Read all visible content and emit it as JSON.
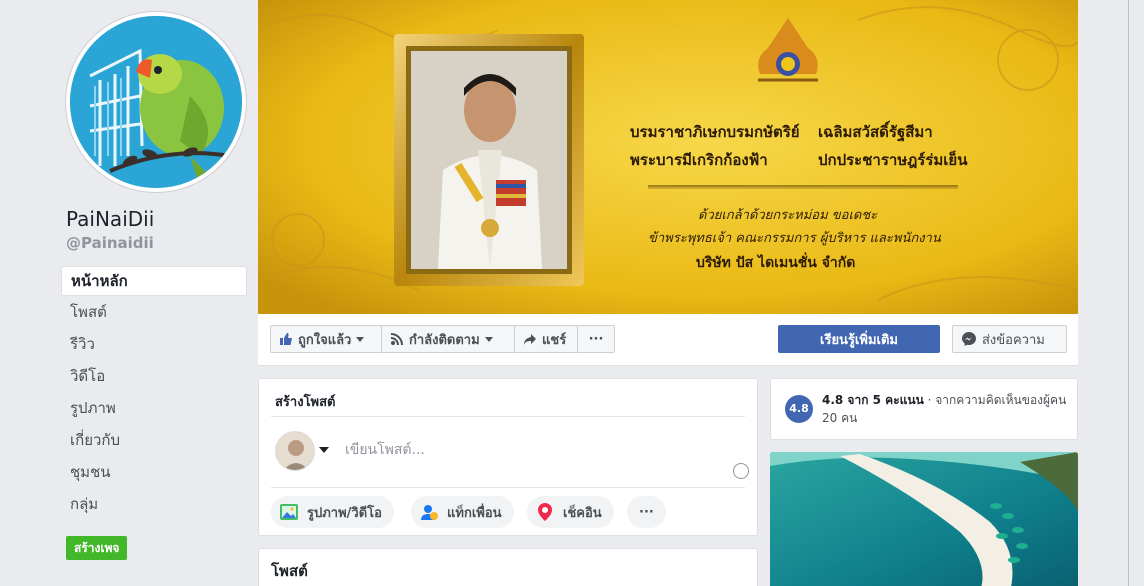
{
  "page": {
    "name": "PaiNaiDii",
    "handle": "@Painaidii"
  },
  "nav": {
    "items": [
      {
        "label": "หน้าหลัก",
        "active": true
      },
      {
        "label": "โพสต์"
      },
      {
        "label": "รีวิว"
      },
      {
        "label": "วิดีโอ"
      },
      {
        "label": "รูปภาพ"
      },
      {
        "label": "เกี่ยวกับ"
      },
      {
        "label": "ชุมชน"
      },
      {
        "label": "กลุ่ม"
      }
    ],
    "create_page_label": "สร้างเพจ"
  },
  "cover": {
    "line1_left": "บรมราชาภิเษกบรมกษัตริย์",
    "line1_right": "เฉลิมสวัสดิ์รัฐสีมา",
    "line2_left": "พระบารมีเกริกก้องฟ้า",
    "line2_right": "ปกประชาราษฎร์ร่มเย็น",
    "line3": "ด้วยเกล้าด้วยกระหม่อม ขอเดชะ",
    "line4": "ข้าพระพุทธเจ้า คณะกรรมการ ผู้บริหาร และพนักงาน",
    "line5": "บริษัท ปัส ไดเมนชั่น จำกัด",
    "colors": {
      "gold": "#f0c419",
      "frame": "#c9a227"
    }
  },
  "actions": {
    "like_label": "ถูกใจแล้ว",
    "follow_label": "กำลังติดตาม",
    "share_label": "แชร์",
    "more_label": "···",
    "learn_more_label": "เรียนรู้เพิ่มเติม",
    "message_label": "ส่งข้อความ"
  },
  "composer": {
    "title": "สร้างโพสต์",
    "placeholder": "เขียนโพสต์...",
    "photo_video_label": "รูปภาพ/วิดีโอ",
    "tag_friends_label": "แท็กเพื่อน",
    "check_in_label": "เช็คอิน",
    "more_label": "···"
  },
  "posts": {
    "title": "โพสต์"
  },
  "rating": {
    "badge": "4.8",
    "score_text": "4.8 จาก 5 คะแนน",
    "separator": " · ",
    "source_text": "จากความคิดเห็นของผู้คน 20 คน"
  },
  "theme": {
    "brand_blue": "#4267b2",
    "green": "#42b72a",
    "background": "#e9ebee"
  }
}
